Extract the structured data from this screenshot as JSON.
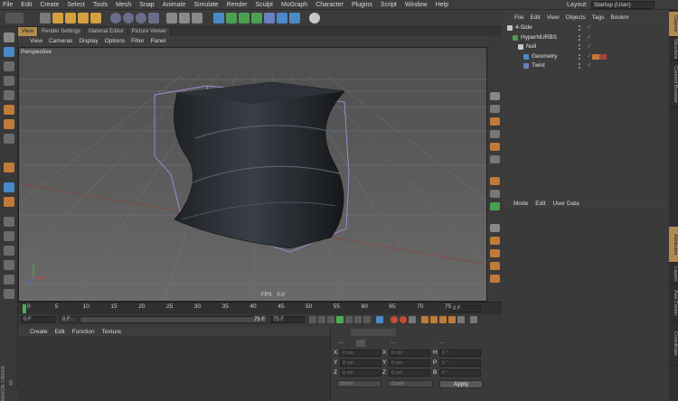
{
  "menubar": {
    "items": [
      "File",
      "Edit",
      "Create",
      "Select",
      "Tools",
      "Mesh",
      "Snap",
      "Animate",
      "Simulate",
      "Render",
      "Sculpt",
      "MoGraph",
      "Character",
      "Plugins",
      "Script",
      "Window",
      "Help"
    ],
    "layout_label": "Layout:",
    "layout_value": "Startup (User)"
  },
  "view_tabs": [
    "View",
    "Render Settings",
    "Material Editor",
    "Picture Viewer"
  ],
  "viewport_menu": [
    "View",
    "Cameras",
    "Display",
    "Options",
    "Filter",
    "Panel"
  ],
  "viewport": {
    "label": "Perspective",
    "fps_label": "FPS",
    "fps_value": "0.0"
  },
  "timeline": {
    "ticks": [
      "0",
      "5",
      "10",
      "15",
      "20",
      "25",
      "30",
      "35",
      "40",
      "45",
      "50",
      "55",
      "60",
      "65",
      "70",
      "75"
    ],
    "end_frame": "0 F",
    "current_frame": "0 F",
    "range_start": "0 F",
    "range_end": "75 F",
    "max_frame": "75 F"
  },
  "material_menu": [
    "Create",
    "Edit",
    "Function",
    "Texture"
  ],
  "coordinates": {
    "header": [
      "---",
      "---",
      "---"
    ],
    "rows": [
      {
        "l1": "X",
        "v1": "0 cm",
        "l2": "X",
        "v2": "0 cm",
        "l3": "H",
        "v3": "0 °"
      },
      {
        "l1": "Y",
        "v1": "0 cm",
        "l2": "Y",
        "v2": "0 cm",
        "l3": "P",
        "v3": "0 °"
      },
      {
        "l1": "Z",
        "v1": "0 cm",
        "l2": "Z",
        "v2": "0 cm",
        "l3": "B",
        "v3": "0 °"
      }
    ],
    "mode_world": "World",
    "mode_scale": "Scale",
    "apply": "Apply"
  },
  "object_menu": [
    "File",
    "Edit",
    "View",
    "Objects",
    "Tags",
    "Bookm"
  ],
  "objects": [
    {
      "name": "4-Side",
      "indent": 0
    },
    {
      "name": "HyperNURBS",
      "indent": 1
    },
    {
      "name": "Null",
      "indent": 2
    },
    {
      "name": "Geometry",
      "indent": 3
    },
    {
      "name": "Twist",
      "indent": 3
    }
  ],
  "attribute_menu": [
    "Mode",
    "Edit",
    "User Data"
  ],
  "side_tabs": [
    "Objects",
    "Structure",
    "Content Browser",
    "Attributes",
    "Layers",
    "Axis Center",
    "Coordinate"
  ],
  "branding": "MAXON CINEMA 4D",
  "colors": {
    "accent": "#b08a52",
    "shape": "#2a2e35",
    "cage": "#a58cd8",
    "xaxis": "#b83a2a"
  }
}
